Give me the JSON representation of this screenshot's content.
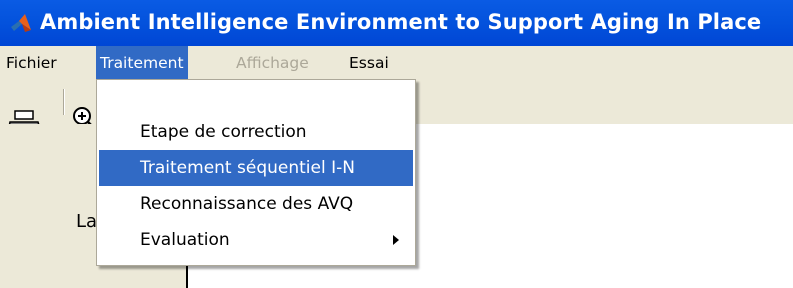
{
  "window": {
    "title": "Ambient Intelligence Environment to Support Aging In Place"
  },
  "menubar": {
    "items": [
      {
        "label": "Fichier",
        "state": "normal"
      },
      {
        "label": "Traitement",
        "state": "selected"
      },
      {
        "label": "Affichage",
        "state": "disabled"
      },
      {
        "label": "Essai",
        "state": "normal"
      }
    ]
  },
  "toolbar": {
    "icons": [
      "print-icon",
      "zoom-in-icon"
    ]
  },
  "dropdown": {
    "parent": "Traitement",
    "items": [
      {
        "label": "Etape de correction",
        "highlighted": false,
        "submenu": false
      },
      {
        "label": "Traitement séquentiel I-N",
        "highlighted": true,
        "submenu": false
      },
      {
        "label": "Reconnaissance des AVQ",
        "highlighted": false,
        "submenu": false
      },
      {
        "label": "Evaluation",
        "highlighted": false,
        "submenu": true
      }
    ]
  },
  "panel": {
    "partial_label": "La"
  },
  "colors": {
    "titlebar": "#0453dd",
    "menu_highlight": "#316ac5",
    "chrome": "#ece9d8",
    "disabled_text": "#aca899"
  }
}
